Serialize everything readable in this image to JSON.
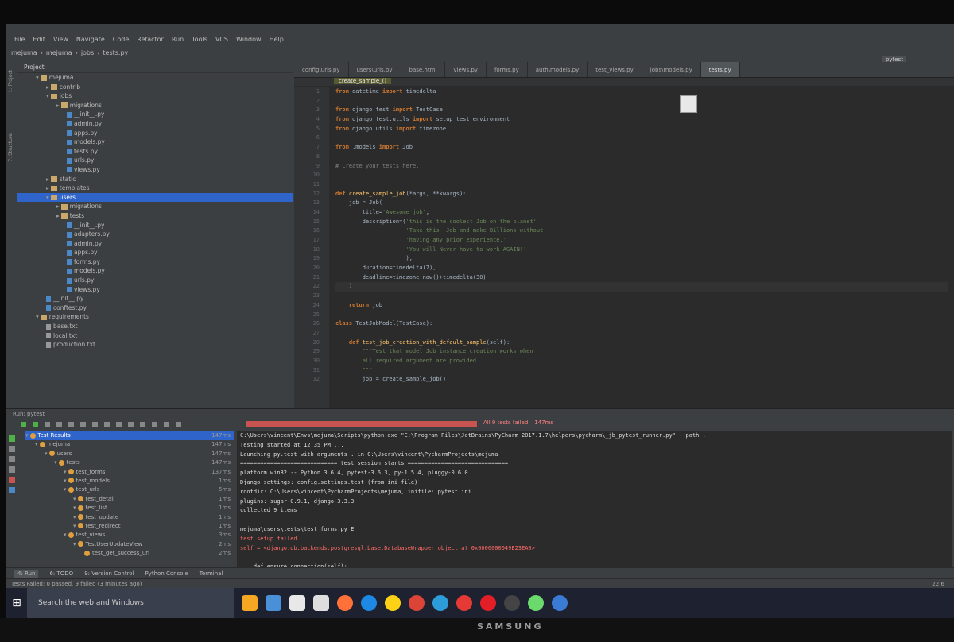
{
  "menu": [
    "File",
    "Edit",
    "View",
    "Navigate",
    "Code",
    "Refactor",
    "Run",
    "Tools",
    "VCS",
    "Window",
    "Help"
  ],
  "nav": [
    "mejuma",
    "mejuma",
    "jobs",
    "tests.py"
  ],
  "run_config": "pytest",
  "project": {
    "title": "Project",
    "items": [
      {
        "t": "mejuma",
        "d": 1,
        "k": "f",
        "o": true
      },
      {
        "t": "contrib",
        "d": 2,
        "k": "f"
      },
      {
        "t": "jobs",
        "d": 2,
        "k": "f",
        "o": true
      },
      {
        "t": "migrations",
        "d": 3,
        "k": "f"
      },
      {
        "t": "__init__.py",
        "d": 4,
        "k": "p"
      },
      {
        "t": "admin.py",
        "d": 4,
        "k": "p"
      },
      {
        "t": "apps.py",
        "d": 4,
        "k": "p"
      },
      {
        "t": "models.py",
        "d": 4,
        "k": "p"
      },
      {
        "t": "tests.py",
        "d": 4,
        "k": "p"
      },
      {
        "t": "urls.py",
        "d": 4,
        "k": "p"
      },
      {
        "t": "views.py",
        "d": 4,
        "k": "p"
      },
      {
        "t": "static",
        "d": 2,
        "k": "f"
      },
      {
        "t": "templates",
        "d": 2,
        "k": "f"
      },
      {
        "t": "users",
        "d": 2,
        "k": "f",
        "o": true,
        "sel": true
      },
      {
        "t": "migrations",
        "d": 3,
        "k": "f"
      },
      {
        "t": "tests",
        "d": 3,
        "k": "f"
      },
      {
        "t": "__init__.py",
        "d": 4,
        "k": "p"
      },
      {
        "t": "adapters.py",
        "d": 4,
        "k": "p"
      },
      {
        "t": "admin.py",
        "d": 4,
        "k": "p"
      },
      {
        "t": "apps.py",
        "d": 4,
        "k": "p"
      },
      {
        "t": "forms.py",
        "d": 4,
        "k": "p"
      },
      {
        "t": "models.py",
        "d": 4,
        "k": "p"
      },
      {
        "t": "urls.py",
        "d": 4,
        "k": "p"
      },
      {
        "t": "views.py",
        "d": 4,
        "k": "p"
      },
      {
        "t": "__init__.py",
        "d": 2,
        "k": "p"
      },
      {
        "t": "conftest.py",
        "d": 2,
        "k": "p"
      },
      {
        "t": "requirements",
        "d": 1,
        "k": "f",
        "o": true
      },
      {
        "t": "base.txt",
        "d": 2,
        "k": "t"
      },
      {
        "t": "local.txt",
        "d": 2,
        "k": "t"
      },
      {
        "t": "production.txt",
        "d": 2,
        "k": "t"
      }
    ]
  },
  "tabs": [
    "config\\urls.py",
    "users\\urls.py",
    "base.html",
    "views.py",
    "forms.py",
    "auth\\models.py",
    "test_views.py",
    "jobs\\models.py",
    "tests.py"
  ],
  "breadcrumb": "create_sample_()",
  "code": [
    "<span class=kw>from</span> datetime <span class=kw>import</span> timedelta",
    "",
    "<span class=kw>from</span> django.test <span class=kw>import</span> TestCase",
    "<span class=kw>from</span> django.test.utils <span class=kw>import</span> setup_test_environment",
    "<span class=kw>from</span> django.utils <span class=kw>import</span> timezone",
    "",
    "<span class=kw>from</span> .models <span class=kw>import</span> Job",
    "",
    "<span class=cm># Create your tests here.</span>",
    "",
    "",
    "<span class=kw>def</span> <span class=fn>create_sample_job</span>(*args, **kwargs):",
    "    job = Job(",
    "        title=<span class=st>'Awesome job'</span>,",
    "        description=(<span class=st>'this is the coolest Job on the planet'</span>",
    "                     <span class=st>'Take this  Job and make Billions without'</span>",
    "                     <span class=st>'having any prior experience.'</span>",
    "                     <span class=st>'You will Never have to work AGAIN!'</span>",
    "                     ),",
    "        duration=timedelta(7),",
    "        deadline=timezone.now()+timedelta(30)",
    "    )",
    "",
    "    <span class=kw>return</span> job",
    "",
    "<span class=kw>class</span> TestJobModel(TestCase):",
    "",
    "    <span class=kw>def</span> <span class=fn>test_job_creation_with_default_sample</span>(self):",
    "        <span class=st>\"\"\"Test that model Job instance creation works when</span>",
    "<span class=st>        all required argument are provided</span>",
    "<span class=st>        \"\"\"</span>",
    "        job = create_sample_job()"
  ],
  "run": {
    "label": "Run",
    "config": "pytest",
    "status": "All 9 tests failed – 147ms",
    "tree": [
      {
        "t": "Test Results",
        "d": 0,
        "ms": "147ms"
      },
      {
        "t": "mejuma",
        "d": 1,
        "ms": "147ms"
      },
      {
        "t": "users",
        "d": 2,
        "ms": "147ms"
      },
      {
        "t": "tests",
        "d": 3,
        "ms": "147ms"
      },
      {
        "t": "test_forms",
        "d": 4,
        "ms": "137ms"
      },
      {
        "t": "test_models",
        "d": 4,
        "ms": "1ms"
      },
      {
        "t": "test_urls",
        "d": 4,
        "ms": "5ms"
      },
      {
        "t": "test_detail",
        "d": 5,
        "ms": "1ms"
      },
      {
        "t": "test_list",
        "d": 5,
        "ms": "1ms"
      },
      {
        "t": "test_update",
        "d": 5,
        "ms": "1ms"
      },
      {
        "t": "test_redirect",
        "d": 5,
        "ms": "1ms"
      },
      {
        "t": "test_views",
        "d": 4,
        "ms": "3ms"
      },
      {
        "t": "TestUserUpdateView",
        "d": 5,
        "ms": "2ms"
      },
      {
        "t": "test_get_success_url",
        "d": 6,
        "ms": "2ms"
      }
    ],
    "console": [
      {
        "t": "C:\\Users\\vincent\\Envs\\mejuma\\Scripts\\python.exe \"C:\\Program Files\\JetBrains\\PyCharm 2017.1.7\\helpers\\pycharm\\_jb_pytest_runner.py\" --path .",
        "e": false
      },
      {
        "t": "Testing started at 12:35 PM ...",
        "e": false
      },
      {
        "t": "Launching py.test with arguments . in C:\\Users\\vincent\\PycharmProjects\\mejuma",
        "e": false
      },
      {
        "t": "============================= test session starts ==============================",
        "e": false
      },
      {
        "t": "platform win32 -- Python 3.6.4, pytest-3.6.3, py-1.5.4, pluggy-0.6.0",
        "e": false
      },
      {
        "t": "Django settings: config.settings.test (from ini file)",
        "e": false
      },
      {
        "t": "rootdir: C:\\Users\\vincent\\PycharmProjects\\mejuma, inifile: pytest.ini",
        "e": false
      },
      {
        "t": "plugins: sugar-0.9.1, django-3.3.3",
        "e": false
      },
      {
        "t": "collected 9 items",
        "e": false
      },
      {
        "t": "",
        "e": false
      },
      {
        "t": "mejuma\\users\\tests\\test_forms.py E",
        "e": false
      },
      {
        "t": "test setup failed",
        "e": true
      },
      {
        "t": "self = <django.db.backends.postgresql.base.DatabaseWrapper object at 0x0000000049E23EA0>",
        "e": true
      },
      {
        "t": "",
        "e": false
      },
      {
        "t": "    def ensure_connection(self):",
        "e": false
      }
    ]
  },
  "toolwindows": [
    "4: Run",
    "6: TODO",
    "9: Version Control",
    "Python Console",
    "Terminal"
  ],
  "status": "Tests Failed: 0 passed, 9 failed (3 minutes ago)",
  "cursor_pos": "22:6",
  "search": "Search the web and Windows",
  "brand": "SAMSUNG",
  "taskbar_colors": [
    "#f5a623",
    "#4a90d9",
    "#e8e8e8",
    "#dedede",
    "#ff7139",
    "#1e88e5",
    "#fcd116",
    "#db4437",
    "#2d9cdb",
    "#e53935",
    "#e41e26",
    "#444",
    "#6bd96b",
    "#3a7bd5"
  ]
}
